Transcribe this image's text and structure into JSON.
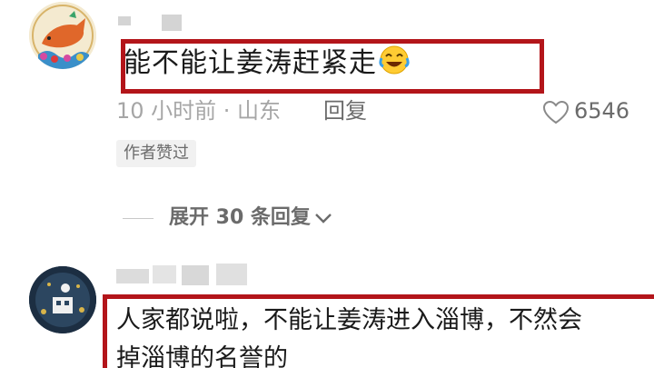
{
  "comment1": {
    "text": "能不能让姜涛赶紧走",
    "meta": "10 小时前 · 山东",
    "reply_label": "回复",
    "like_count": "6546",
    "author_badge": "作者赞过",
    "expand_replies": "展开 30 条回复"
  },
  "comment2": {
    "text_line1": "人家都说啦，不能让姜涛进入淄博，不然会",
    "text_line2": "掉淄博的名誉的"
  },
  "colors": {
    "highlight_border": "#b3151a",
    "meta_text": "#a6a6a6",
    "secondary_text": "#6b6b6b"
  }
}
